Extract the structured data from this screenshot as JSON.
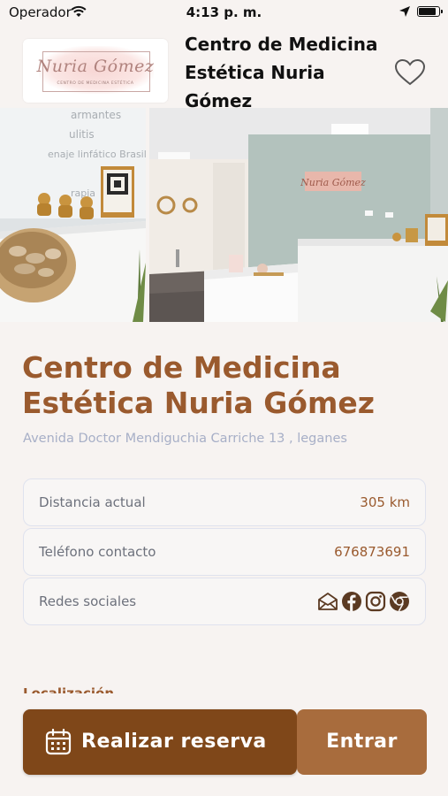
{
  "status_bar": {
    "carrier": "Operador",
    "time": "4:13 p. m."
  },
  "header": {
    "title": "Centro de Medicina Estética Nuria Gómez",
    "logo_text": "Nuria Gómez",
    "logo_tagline": "CENTRO DE MEDICINA ESTÉTICA",
    "favorite_icon": "heart-outline-icon"
  },
  "photo_left": {
    "wall_text": [
      "armantes",
      "ulitis",
      "enaje linfático Brasileño",
      "etox",
      "rapia"
    ]
  },
  "photo_right": {
    "sign_text": "Nuria Gómez"
  },
  "clinic": {
    "name": "Centro de Medicina Estética Nuria Gómez",
    "address": "Avenida Doctor Mendiguchia Carriche 13 , leganes"
  },
  "info_rows": {
    "distance": {
      "label": "Distancia actual",
      "value": "305 km"
    },
    "phone": {
      "label": "Teléfono contacto",
      "value": "676873691"
    },
    "social": {
      "label": "Redes sociales",
      "icons": [
        "mail-icon",
        "facebook-icon",
        "instagram-icon",
        "chrome-icon"
      ]
    }
  },
  "section_peek": "Localización",
  "actions": {
    "reserve_label": "Realizar reserva",
    "enter_label": "Entrar"
  },
  "colors": {
    "accent": "#9a5a2e",
    "reserve_button": "#7f4719",
    "enter_button": "#a86c3d",
    "background": "#f7f3f1",
    "address": "#a7afc7"
  }
}
